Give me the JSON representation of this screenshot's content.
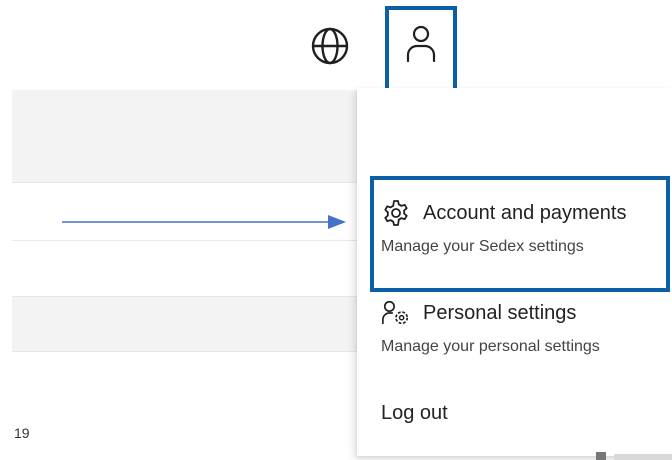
{
  "header": {
    "globe_icon": "globe-icon",
    "profile_icon": "user-icon"
  },
  "menu": {
    "items": [
      {
        "label": "Account and payments",
        "description": "Manage your Sedex settings",
        "icon": "gear-icon"
      },
      {
        "label": "Personal settings",
        "description": "Manage your personal settings",
        "icon": "user-settings-icon"
      },
      {
        "label": "Log out"
      }
    ]
  },
  "background": {
    "page_number": "19"
  },
  "colors": {
    "highlight": "#0b5fa8",
    "arrow": "#4472c4"
  }
}
